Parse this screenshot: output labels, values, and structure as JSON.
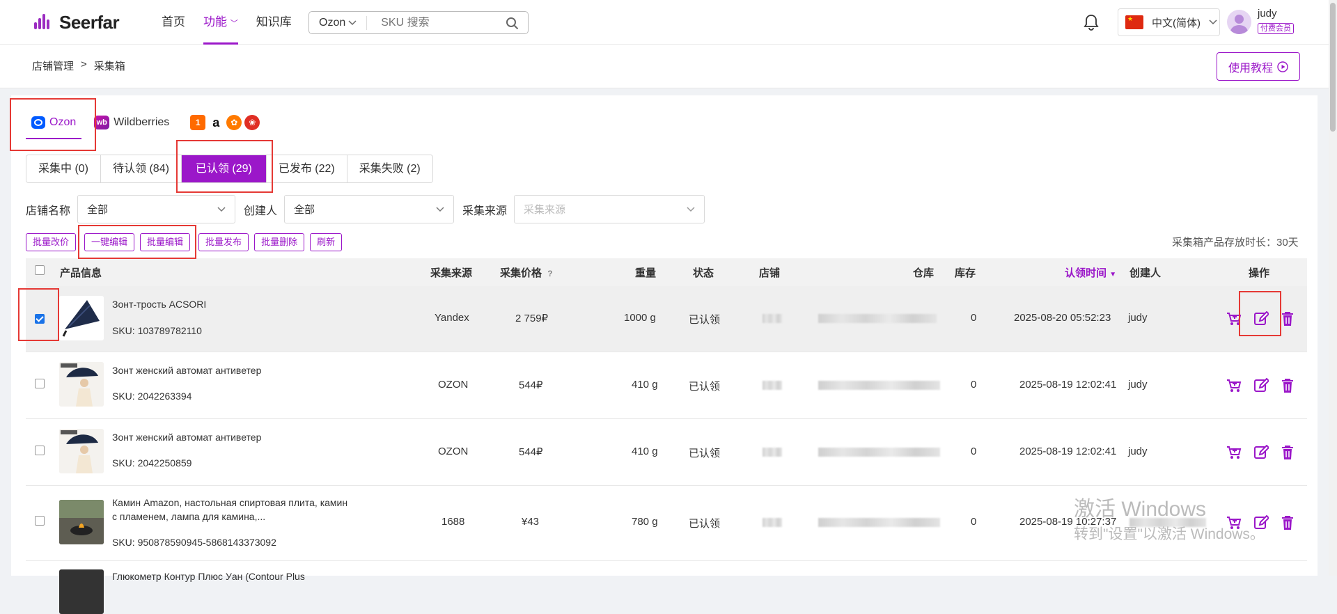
{
  "app": {
    "brand": "Seerfar",
    "nav": [
      "首页",
      "功能",
      "知识库"
    ],
    "search": {
      "platform": "Ozon",
      "placeholder": "SKU 搜索"
    },
    "language": "中文(简体)",
    "user": {
      "name": "judy",
      "badge": "付费会员"
    }
  },
  "breadcrumb": {
    "root": "店铺管理",
    "separator": ">",
    "current": "采集箱"
  },
  "tutorial_button": "使用教程",
  "platform_tabs": {
    "ozon": "Ozon",
    "wildberries": "Wildberries",
    "active": "Ozon"
  },
  "status_tabs": [
    "采集中 (0)",
    "待认领 (84)",
    "已认领 (29)",
    "已发布 (22)",
    "采集失败 (2)"
  ],
  "active_status_tab": "已认领 (29)",
  "filters": {
    "store_label": "店铺名称",
    "store_value": "全部",
    "creator_label": "创建人",
    "creator_value": "全部",
    "source_label": "采集来源",
    "source_placeholder": "采集来源"
  },
  "batch_actions": [
    "批量改价",
    "一键编辑",
    "批量编辑",
    "批量发布",
    "批量删除",
    "刷新"
  ],
  "retention_text": "采集箱产品存放时长：30天",
  "columns": {
    "product": "产品信息",
    "source": "采集来源",
    "price": "采集价格",
    "price_help": "?",
    "weight": "重量",
    "status": "状态",
    "store": "店铺",
    "warehouse": "仓库",
    "stock": "库存",
    "claim_time": "认领时间",
    "creator": "创建人",
    "ops": "操作"
  },
  "rows": [
    {
      "name": "Зонт-трость ACSORI",
      "sku": "SKU: 103789782110",
      "source": "Yandex",
      "price": "2 759₽",
      "weight": "1000 g",
      "status": "已认领",
      "stock": "0",
      "claim_time": "2025-08-20 05:52:23",
      "creator": "judy",
      "checked": true
    },
    {
      "name": "Зонт женский автомат антиветер",
      "sku": "SKU: 2042263394",
      "source": "OZON",
      "price": "544₽",
      "weight": "410 g",
      "status": "已认领",
      "stock": "0",
      "claim_time": "2025-08-19 12:02:41",
      "creator": "judy",
      "checked": false
    },
    {
      "name": "Зонт женский автомат антиветер",
      "sku": "SKU: 2042250859",
      "source": "OZON",
      "price": "544₽",
      "weight": "410 g",
      "status": "已认领",
      "stock": "0",
      "claim_time": "2025-08-19 12:02:41",
      "creator": "judy",
      "checked": false
    },
    {
      "name": "Камин Amazon, настольная спиртовая плита, камин с пламенем, лампа для камина,...",
      "sku": "SKU: 950878590945-5868143373092",
      "source": "1688",
      "price": "¥43",
      "weight": "780 g",
      "status": "已认领",
      "stock": "0",
      "claim_time": "2025-08-19 10:27:37",
      "creator": "",
      "checked": false
    },
    {
      "name": "Глюкометр Контур Плюс Уан (Contour Plus",
      "sku": "",
      "source": "",
      "price": "",
      "weight": "",
      "status": "",
      "stock": "",
      "claim_time": "",
      "creator": "",
      "checked": false
    }
  ],
  "watermark": {
    "line1": "激活 Windows",
    "line2": "转到\"设置\"以激活 Windows。"
  },
  "colors": {
    "accent": "#9b17c9",
    "highlight_box": "#e53935",
    "checkbox": "#1a73e8"
  }
}
